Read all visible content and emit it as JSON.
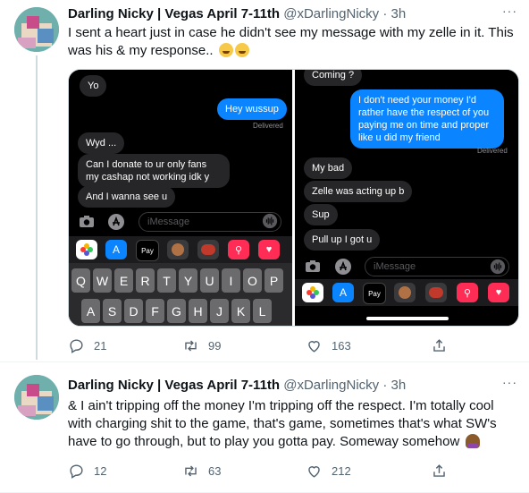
{
  "tweets": [
    {
      "display_name": "Darling Nicky | Vegas April 7-11th",
      "handle": "@xDarlingNicky",
      "time": "· 3h",
      "text": "I sent a heart just in case he didn't see my message with my zelle in it. This was his & my response..",
      "reply_count": "21",
      "retweet_count": "99",
      "like_count": "163"
    },
    {
      "display_name": "Darling Nicky | Vegas April 7-11th",
      "handle": "@xDarlingNicky",
      "time": "· 3h",
      "text": "& I ain't tripping off the money I'm tripping off the respect. I'm totally cool with charging shit to the game, that's game, sometimes that's what SW's have to go through, but to play you gotta pay. Someway somehow",
      "reply_count": "12",
      "retweet_count": "63",
      "like_count": "212"
    }
  ],
  "more_glyph": "···",
  "screenshot_left": {
    "messages": [
      {
        "from": "them",
        "text": "Yo"
      },
      {
        "from": "me",
        "text": "Hey wussup"
      },
      {
        "from": "them",
        "text": "Wyd ..."
      },
      {
        "from": "them",
        "text": "Can I donate to ur only fans my cashap not working idk y"
      },
      {
        "from": "them",
        "text": "And I wanna see u"
      }
    ],
    "delivered": "Delivered",
    "input_placeholder": "iMessage",
    "apple_pay_label": "Pay",
    "keyboard_row1": [
      "Q",
      "W",
      "E",
      "R",
      "T",
      "Y",
      "U",
      "I",
      "O",
      "P"
    ],
    "keyboard_row2": [
      "A",
      "S",
      "D",
      "F",
      "G",
      "H",
      "J",
      "K",
      "L"
    ]
  },
  "screenshot_right": {
    "messages": [
      {
        "from": "them",
        "text": "Coming ?"
      },
      {
        "from": "me",
        "text": "I don't need your money I'd rather have the respect of you paying me on time and proper like u did my friend"
      },
      {
        "from": "them",
        "text": "My bad"
      },
      {
        "from": "them",
        "text": "Zelle was acting up b"
      },
      {
        "from": "them",
        "text": "Sup"
      },
      {
        "from": "them",
        "text": "Pull up I got u"
      }
    ],
    "delivered": "Delivered",
    "input_placeholder": "iMessage",
    "apple_pay_label": "Pay"
  },
  "colors": {
    "imessage_blue": "#0a84ff",
    "bubble_gray": "#262629",
    "action_gray": "#536471",
    "thread_line": "#cfd9de"
  },
  "icons": [
    "reply-icon",
    "retweet-icon",
    "like-icon",
    "share-icon",
    "camera-icon",
    "app-store-icon",
    "audio-waveform-icon",
    "photos-app-icon",
    "memoji-icon",
    "search-images-icon",
    "heart-app-icon",
    "emoji-joy",
    "emoji-person-facepalm"
  ]
}
